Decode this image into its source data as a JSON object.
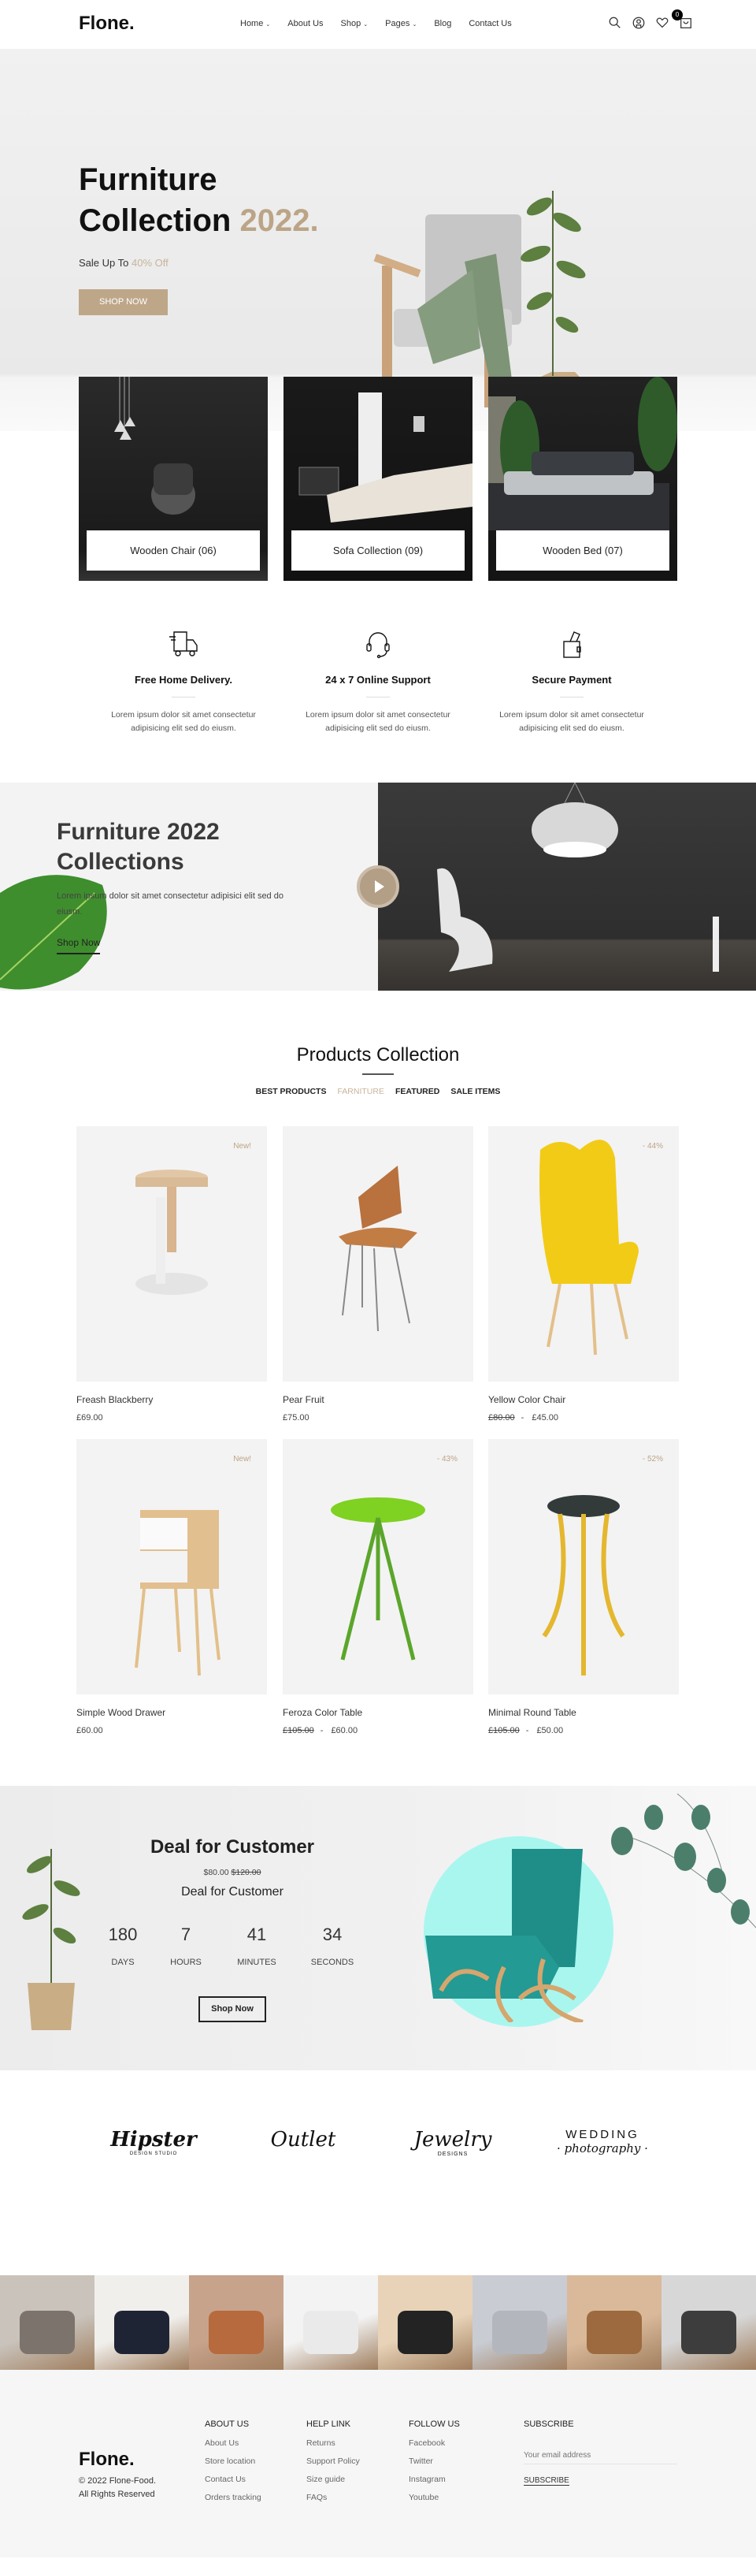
{
  "colors": {
    "accent": "#bca487",
    "button": "#bea789",
    "deal_circle": "#a9f6ef",
    "footer_bg": "#f6f6f6"
  },
  "header": {
    "logo": "Flone.",
    "nav": [
      {
        "label": "Home",
        "dropdown": true
      },
      {
        "label": "About Us"
      },
      {
        "label": "Shop",
        "dropdown": true
      },
      {
        "label": "Pages",
        "dropdown": true
      },
      {
        "label": "Blog"
      },
      {
        "label": "Contact Us"
      }
    ],
    "icons": [
      "search-icon",
      "user-icon",
      "heart-icon",
      "cart-icon"
    ],
    "cart_count": "0"
  },
  "hero": {
    "title_line1": "Furniture",
    "title_line2": "Collection",
    "title_accent": "2022.",
    "sale_prefix": "Sale Up To",
    "sale_accent": "40% Off",
    "button": "SHOP NOW"
  },
  "categories": [
    {
      "label": "Wooden Chair (06)"
    },
    {
      "label": "Sofa Collection (09)"
    },
    {
      "label": "Wooden Bed (07)"
    }
  ],
  "features": [
    {
      "icon": "delivery-truck-icon",
      "title": "Free Home Delivery.",
      "text": "Lorem ipsum dolor sit amet consectetur adipisicing elit sed do eiusm."
    },
    {
      "icon": "headset-icon",
      "title": "24 x 7 Online Support",
      "text": "Lorem ipsum dolor sit amet consectetur adipisicing elit sed do eiusm."
    },
    {
      "icon": "wallet-icon",
      "title": "Secure Payment",
      "text": "Lorem ipsum dolor sit amet consectetur adipisicing elit sed do eiusm."
    }
  ],
  "banner": {
    "title_line1": "Furniture 2022",
    "title_line2": "Collections",
    "text": "Lorem ipsum dolor sit amet consectetur adipisici elit sed do eiusm.",
    "link": "Shop Now"
  },
  "products_section": {
    "title": "Products Collection",
    "tabs": [
      {
        "label": "BEST PRODUCTS"
      },
      {
        "label": "FARNITURE",
        "active": true
      },
      {
        "label": "FEATURED"
      },
      {
        "label": "SALE ITEMS"
      }
    ]
  },
  "products": [
    {
      "name": "Freash Blackberry",
      "price": "£69.00",
      "old_price": "",
      "badge": "New!"
    },
    {
      "name": "Pear Fruit",
      "price": "£75.00",
      "old_price": "",
      "badge": ""
    },
    {
      "name": "Yellow Color Chair",
      "price": "£45.00",
      "old_price": "£80.00",
      "badge": "- 44%"
    },
    {
      "name": "Simple Wood Drawer",
      "price": "£60.00",
      "old_price": "",
      "badge": "New!"
    },
    {
      "name": "Feroza Color Table",
      "price": "£60.00",
      "old_price": "£105.00",
      "badge": "- 43%"
    },
    {
      "name": "Minimal Round Table",
      "price": "£50.00",
      "old_price": "£105.00",
      "badge": "- 52%"
    }
  ],
  "deal": {
    "title": "Deal for Customer",
    "price": "$80.00",
    "old_price": "$120.00",
    "subtitle": "Deal for Customer",
    "countdown": [
      {
        "value": "180",
        "label": "DAYS"
      },
      {
        "value": "7",
        "label": "HOURS"
      },
      {
        "value": "41",
        "label": "MINUTES"
      },
      {
        "value": "34",
        "label": "SECONDS"
      }
    ],
    "button": "Shop Now"
  },
  "brands": [
    {
      "name": "Hipster",
      "sub": "DESIGN STUDIO"
    },
    {
      "name": "Outlet",
      "sub": ""
    },
    {
      "name": "Jewelry",
      "sub": "DESIGNS"
    },
    {
      "name": "WEDDING",
      "sub": "· photography ·"
    }
  ],
  "footer": {
    "logo": "Flone.",
    "copyright_line1": "© 2022 Flone-Food.",
    "copyright_line2": "All Rights Reserved",
    "columns": [
      {
        "title": "ABOUT US",
        "items": [
          "About Us",
          "Store location",
          "Contact Us",
          "Orders tracking"
        ]
      },
      {
        "title": "HELP LINK",
        "items": [
          "Returns",
          "Support Policy",
          "Size guide",
          "FAQs"
        ]
      },
      {
        "title": "FOLLOW US",
        "items": [
          "Facebook",
          "Twitter",
          "Instagram",
          "Youtube"
        ]
      }
    ],
    "subscribe": {
      "title": "SUBSCRIBE",
      "placeholder": "Your email address",
      "button": "SUBSCRIBE"
    }
  }
}
